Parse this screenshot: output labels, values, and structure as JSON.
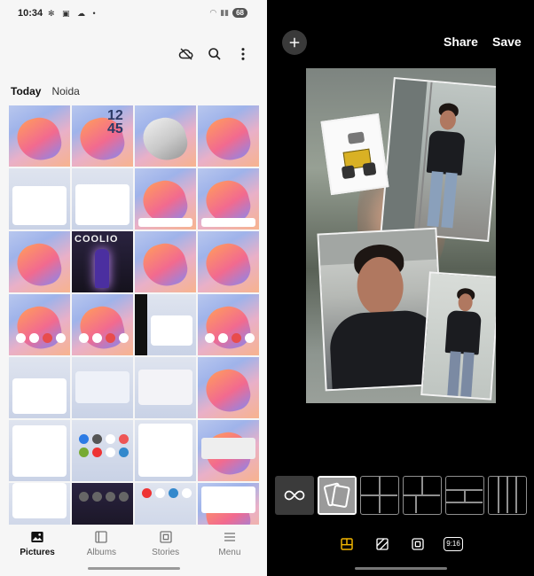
{
  "left": {
    "status": {
      "time": "10:34",
      "battery": "68"
    },
    "tabs": {
      "today": "Today",
      "noida": "Noida"
    },
    "grid_texts": {
      "clock": "12\n45",
      "album": "COOLIO"
    },
    "nav": [
      {
        "label": "Pictures",
        "icon": "image-icon",
        "active": true
      },
      {
        "label": "Albums",
        "icon": "album-icon",
        "active": false
      },
      {
        "label": "Stories",
        "icon": "stories-icon",
        "active": false
      },
      {
        "label": "Menu",
        "icon": "menu-icon",
        "active": false
      }
    ]
  },
  "right": {
    "share_label": "Share",
    "save_label": "Save",
    "ratio_label": "9:16",
    "colors": {
      "accent": "#f2b600",
      "background": "#000000"
    }
  }
}
